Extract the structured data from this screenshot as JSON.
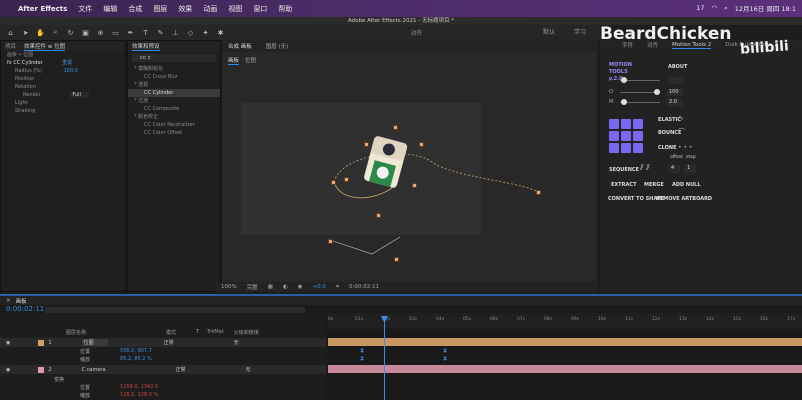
{
  "menubar": {
    "app": "After Effects",
    "items": [
      "文件",
      "编辑",
      "合成",
      "图层",
      "效果",
      "动画",
      "视图",
      "窗口",
      "帮助"
    ],
    "datetime": "12月16日 周四 18:1",
    "battery": "17"
  },
  "window": {
    "title": "Adobe After Effects 2021 - 无标题项目 *"
  },
  "toolbar": {
    "snap_label": "对齐",
    "workspaces": [
      "默认",
      "学习"
    ]
  },
  "watermark": {
    "text": "BeardChicken",
    "site": "bilibili"
  },
  "left_panel": {
    "tabs": [
      "项目",
      "效果控件 ≡ 位图"
    ],
    "layer_path": "画板 • 位图",
    "effect_name": "CC Cylinder",
    "reset_label": "重置",
    "props": [
      {
        "name": "Radius (%)",
        "value": "100.0"
      },
      {
        "name": "Position",
        "value": ""
      },
      {
        "name": "Rotation",
        "value": ""
      },
      {
        "name": "Render",
        "value": "Full"
      },
      {
        "name": "Light",
        "value": ""
      },
      {
        "name": "Shading",
        "value": ""
      }
    ]
  },
  "effects_panel": {
    "title": "效果和预设",
    "search": "cc c",
    "groups": [
      {
        "cat": "* 模糊和锐化",
        "items": [
          "CC Cross Blur"
        ]
      },
      {
        "cat": "* 透视",
        "items": [
          "CC Cylinder"
        ]
      },
      {
        "cat": "* 过渡",
        "items": [
          "CC Composite"
        ]
      },
      {
        "cat": "* 颜色校正",
        "items": [
          "CC Color Neutralizer",
          "CC Color Offset"
        ]
      }
    ]
  },
  "comp_panel": {
    "tab": "合成 画板",
    "tab2": "图层 (无)",
    "breadcrumb": [
      "画板",
      "位图"
    ],
    "zoom": "100%",
    "quality": "完整",
    "exposure": "+0.0",
    "time": "0:00:02:11"
  },
  "right_panel": {
    "tabs": [
      "字符",
      "对齐",
      "Motion Tools 2"
    ],
    "extra_tab": "Duik Rubberhose 2",
    "title": "MOTION TOOLS v.2.0",
    "about": "ABOUT",
    "sliders": [
      {
        "label": "I",
        "value": ""
      },
      {
        "label": "O",
        "value": "100"
      },
      {
        "label": "M",
        "value": "2.0"
      }
    ],
    "sliders_fill": [
      0.1,
      0.95,
      0.1
    ],
    "buttons": [
      "ELASTIC",
      "BOUNCE",
      "CLONE"
    ],
    "offset_label": "offset",
    "step_label": "step",
    "seq_label": "SEQUENCE",
    "offset_val": "4",
    "step_val": "1",
    "actions": [
      "EXTRACT",
      "MERGE",
      "ADD NULL"
    ],
    "actions2": [
      "CONVERT TO SHAPE",
      "REMOVE ARTBOARD"
    ]
  },
  "timeline": {
    "tab": "画板",
    "time": "0:00:02:11",
    "fps": "00071 (30.00 fps)",
    "columns": [
      "图层名称",
      "模式",
      "T",
      "TrkMat",
      "父级和链接"
    ],
    "ruler": [
      "0s",
      "01s",
      "02s",
      "03s",
      "04s",
      "05s",
      "06s",
      "07s",
      "08s",
      "09s",
      "10s",
      "11s",
      "12s",
      "13s",
      "14s",
      "15s",
      "16s",
      "17s"
    ],
    "layers": [
      {
        "num": "1",
        "name": "位图",
        "mode": "正常",
        "parent": "无",
        "color": "#d2a060"
      },
      {
        "num": "",
        "name": "位置",
        "mode": "",
        "parent": "",
        "value": "556.0, 907.7"
      },
      {
        "num": "",
        "name": "缩放",
        "mode": "",
        "parent": "",
        "value": "85.2, 85.2 %"
      },
      {
        "num": "2",
        "name": "C camera",
        "mode": "正常",
        "parent": "无",
        "color": "#e29aa8"
      },
      {
        "num": "",
        "name": "变换",
        "mode": "",
        "parent": "",
        "value": ""
      },
      {
        "num": "",
        "name": "位置",
        "mode": "",
        "parent": "",
        "value": "1158.0, 1342.0"
      },
      {
        "num": "",
        "name": "缩放",
        "mode": "",
        "parent": "",
        "value": "128.0, 128.0 %"
      }
    ]
  },
  "colors": {
    "menubar": "#4a2c66",
    "accent": "#2d8ceb",
    "mt_purple": "#7b68f0",
    "layer1": "#d2a060",
    "layer2": "#e29aa8"
  }
}
